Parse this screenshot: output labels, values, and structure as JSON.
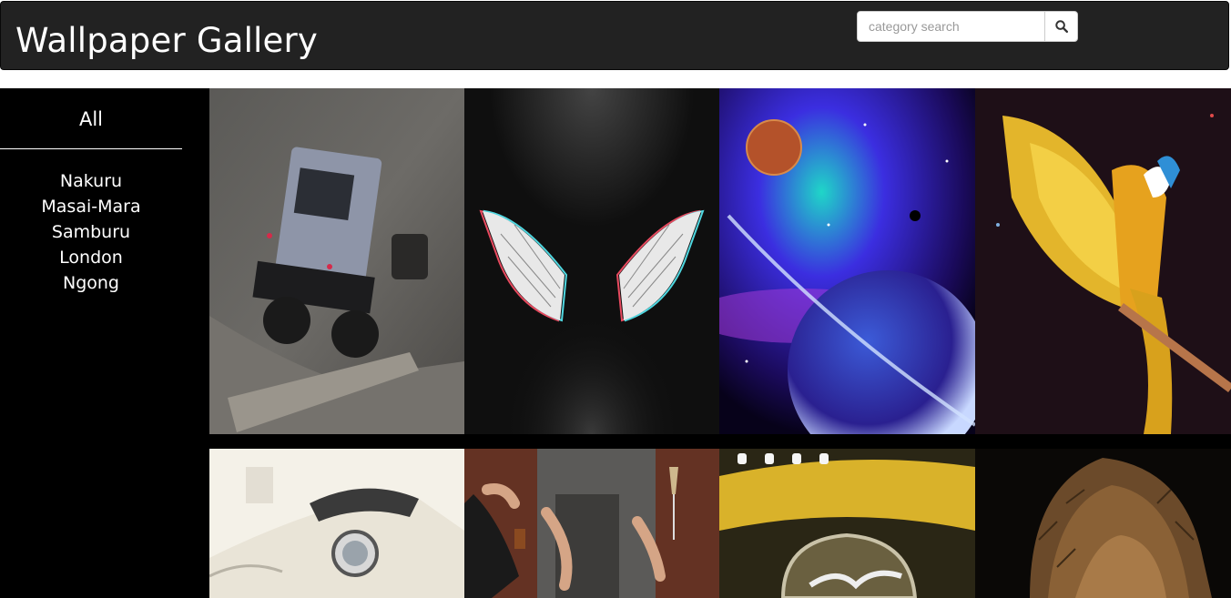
{
  "header": {
    "title": "Wallpaper Gallery",
    "search_placeholder": "category search",
    "search_icon": "search-icon"
  },
  "sidebar": {
    "all_label": "All",
    "items": [
      {
        "label": "Nakuru"
      },
      {
        "label": "Masai-Mara"
      },
      {
        "label": "Samburu"
      },
      {
        "label": "London"
      },
      {
        "label": "Ngong"
      }
    ]
  },
  "gallery": {
    "images": [
      {
        "subject": "off-road jeep on rocky trail"
      },
      {
        "subject": "glitch angel wings"
      },
      {
        "subject": "space planets and nebula"
      },
      {
        "subject": "macaw parrot with spread wings"
      },
      {
        "subject": "vintage white car"
      },
      {
        "subject": "people toasting with wine glasses"
      },
      {
        "subject": "yellow car badge"
      },
      {
        "subject": "lion portrait"
      }
    ]
  },
  "colors": {
    "navbar_bg": "#222222",
    "sidebar_bg": "#000000",
    "text": "#ffffff"
  }
}
